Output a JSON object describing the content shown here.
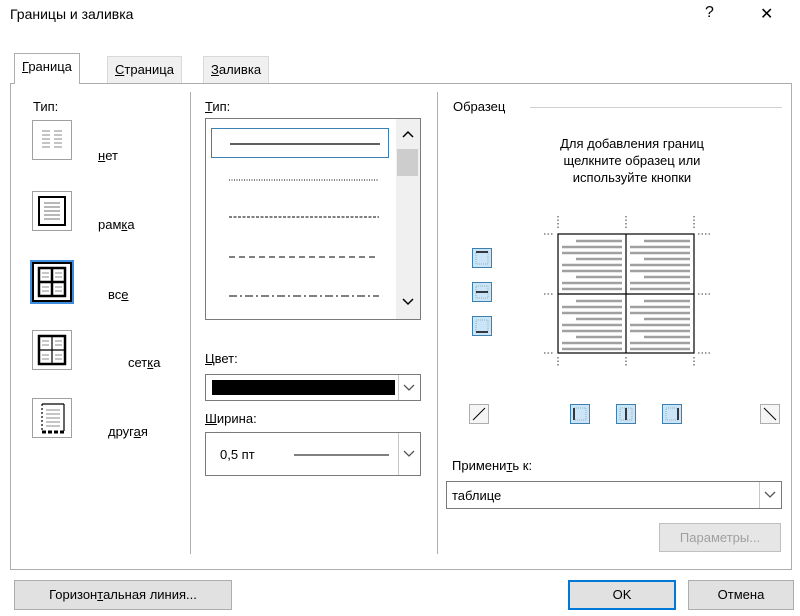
{
  "window": {
    "title": "Границы и заливка",
    "help_glyph": "?",
    "close_glyph": "✕"
  },
  "tabs": [
    {
      "pre": "",
      "u": "Г",
      "post": "раница",
      "active": true
    },
    {
      "pre": "",
      "u": "С",
      "post": "траница",
      "active": false
    },
    {
      "pre": "",
      "u": "З",
      "post": "аливка",
      "active": false
    }
  ],
  "setting": {
    "label": "Тип:",
    "items": [
      {
        "pre": "",
        "u": "н",
        "post": "ет",
        "icon": "none-setting-icon"
      },
      {
        "pre": "рам",
        "u": "к",
        "post": "а",
        "icon": "box-setting-icon"
      },
      {
        "pre": "вс",
        "u": "е",
        "post": "",
        "icon": "all-setting-icon",
        "selected": true
      },
      {
        "pre": "сет",
        "u": "к",
        "post": "а",
        "icon": "grid-setting-icon"
      },
      {
        "pre": "друг",
        "u": "а",
        "post": "я",
        "icon": "custom-setting-icon"
      }
    ]
  },
  "style": {
    "label_pre": "",
    "label_u": "Т",
    "label_post": "ип:",
    "lines": [
      "solid",
      "dotted",
      "dashed-fine",
      "dashed",
      "dash-dot"
    ]
  },
  "color": {
    "label_pre": "",
    "label_u": "Ц",
    "label_post": "вет:",
    "value": "#000000"
  },
  "width": {
    "label_pre": "",
    "label_u": "Ш",
    "label_post": "ирина:",
    "value": "0,5 пт"
  },
  "preview": {
    "label": "Образец",
    "hint": "Для добавления границ щелкните образец или используйте кнопки"
  },
  "apply": {
    "label_pre": "Примени",
    "label_u": "т",
    "label_post": "ь к:",
    "value": "таблице"
  },
  "buttons": {
    "options": "Параметры...",
    "hline_pre": "Горизон",
    "hline_u": "т",
    "hline_post": "альная линия...",
    "ok": "OK",
    "cancel": "Отмена"
  }
}
